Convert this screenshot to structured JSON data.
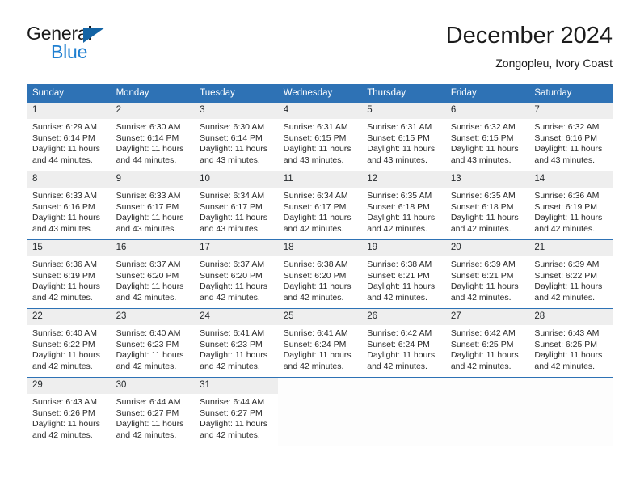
{
  "brand": {
    "word_one": "General",
    "word_two": "Blue",
    "logo_icon": "triangle-logo-icon",
    "color_blue": "#1f7fd0",
    "color_triangle": "#1464a5"
  },
  "header": {
    "title": "December 2024",
    "subtitle": "Zongopleu, Ivory Coast"
  },
  "calendar": {
    "header_color": "#2e72b5",
    "daynum_bg": "#eeeeee",
    "weekday_headers": [
      "Sunday",
      "Monday",
      "Tuesday",
      "Wednesday",
      "Thursday",
      "Friday",
      "Saturday"
    ],
    "weeks": [
      [
        {
          "day": "1",
          "sunrise": "Sunrise: 6:29 AM",
          "sunset": "Sunset: 6:14 PM",
          "daylight_line1": "Daylight: 11 hours",
          "daylight_line2": "and 44 minutes."
        },
        {
          "day": "2",
          "sunrise": "Sunrise: 6:30 AM",
          "sunset": "Sunset: 6:14 PM",
          "daylight_line1": "Daylight: 11 hours",
          "daylight_line2": "and 44 minutes."
        },
        {
          "day": "3",
          "sunrise": "Sunrise: 6:30 AM",
          "sunset": "Sunset: 6:14 PM",
          "daylight_line1": "Daylight: 11 hours",
          "daylight_line2": "and 43 minutes."
        },
        {
          "day": "4",
          "sunrise": "Sunrise: 6:31 AM",
          "sunset": "Sunset: 6:15 PM",
          "daylight_line1": "Daylight: 11 hours",
          "daylight_line2": "and 43 minutes."
        },
        {
          "day": "5",
          "sunrise": "Sunrise: 6:31 AM",
          "sunset": "Sunset: 6:15 PM",
          "daylight_line1": "Daylight: 11 hours",
          "daylight_line2": "and 43 minutes."
        },
        {
          "day": "6",
          "sunrise": "Sunrise: 6:32 AM",
          "sunset": "Sunset: 6:15 PM",
          "daylight_line1": "Daylight: 11 hours",
          "daylight_line2": "and 43 minutes."
        },
        {
          "day": "7",
          "sunrise": "Sunrise: 6:32 AM",
          "sunset": "Sunset: 6:16 PM",
          "daylight_line1": "Daylight: 11 hours",
          "daylight_line2": "and 43 minutes."
        }
      ],
      [
        {
          "day": "8",
          "sunrise": "Sunrise: 6:33 AM",
          "sunset": "Sunset: 6:16 PM",
          "daylight_line1": "Daylight: 11 hours",
          "daylight_line2": "and 43 minutes."
        },
        {
          "day": "9",
          "sunrise": "Sunrise: 6:33 AM",
          "sunset": "Sunset: 6:17 PM",
          "daylight_line1": "Daylight: 11 hours",
          "daylight_line2": "and 43 minutes."
        },
        {
          "day": "10",
          "sunrise": "Sunrise: 6:34 AM",
          "sunset": "Sunset: 6:17 PM",
          "daylight_line1": "Daylight: 11 hours",
          "daylight_line2": "and 43 minutes."
        },
        {
          "day": "11",
          "sunrise": "Sunrise: 6:34 AM",
          "sunset": "Sunset: 6:17 PM",
          "daylight_line1": "Daylight: 11 hours",
          "daylight_line2": "and 42 minutes."
        },
        {
          "day": "12",
          "sunrise": "Sunrise: 6:35 AM",
          "sunset": "Sunset: 6:18 PM",
          "daylight_line1": "Daylight: 11 hours",
          "daylight_line2": "and 42 minutes."
        },
        {
          "day": "13",
          "sunrise": "Sunrise: 6:35 AM",
          "sunset": "Sunset: 6:18 PM",
          "daylight_line1": "Daylight: 11 hours",
          "daylight_line2": "and 42 minutes."
        },
        {
          "day": "14",
          "sunrise": "Sunrise: 6:36 AM",
          "sunset": "Sunset: 6:19 PM",
          "daylight_line1": "Daylight: 11 hours",
          "daylight_line2": "and 42 minutes."
        }
      ],
      [
        {
          "day": "15",
          "sunrise": "Sunrise: 6:36 AM",
          "sunset": "Sunset: 6:19 PM",
          "daylight_line1": "Daylight: 11 hours",
          "daylight_line2": "and 42 minutes."
        },
        {
          "day": "16",
          "sunrise": "Sunrise: 6:37 AM",
          "sunset": "Sunset: 6:20 PM",
          "daylight_line1": "Daylight: 11 hours",
          "daylight_line2": "and 42 minutes."
        },
        {
          "day": "17",
          "sunrise": "Sunrise: 6:37 AM",
          "sunset": "Sunset: 6:20 PM",
          "daylight_line1": "Daylight: 11 hours",
          "daylight_line2": "and 42 minutes."
        },
        {
          "day": "18",
          "sunrise": "Sunrise: 6:38 AM",
          "sunset": "Sunset: 6:20 PM",
          "daylight_line1": "Daylight: 11 hours",
          "daylight_line2": "and 42 minutes."
        },
        {
          "day": "19",
          "sunrise": "Sunrise: 6:38 AM",
          "sunset": "Sunset: 6:21 PM",
          "daylight_line1": "Daylight: 11 hours",
          "daylight_line2": "and 42 minutes."
        },
        {
          "day": "20",
          "sunrise": "Sunrise: 6:39 AM",
          "sunset": "Sunset: 6:21 PM",
          "daylight_line1": "Daylight: 11 hours",
          "daylight_line2": "and 42 minutes."
        },
        {
          "day": "21",
          "sunrise": "Sunrise: 6:39 AM",
          "sunset": "Sunset: 6:22 PM",
          "daylight_line1": "Daylight: 11 hours",
          "daylight_line2": "and 42 minutes."
        }
      ],
      [
        {
          "day": "22",
          "sunrise": "Sunrise: 6:40 AM",
          "sunset": "Sunset: 6:22 PM",
          "daylight_line1": "Daylight: 11 hours",
          "daylight_line2": "and 42 minutes."
        },
        {
          "day": "23",
          "sunrise": "Sunrise: 6:40 AM",
          "sunset": "Sunset: 6:23 PM",
          "daylight_line1": "Daylight: 11 hours",
          "daylight_line2": "and 42 minutes."
        },
        {
          "day": "24",
          "sunrise": "Sunrise: 6:41 AM",
          "sunset": "Sunset: 6:23 PM",
          "daylight_line1": "Daylight: 11 hours",
          "daylight_line2": "and 42 minutes."
        },
        {
          "day": "25",
          "sunrise": "Sunrise: 6:41 AM",
          "sunset": "Sunset: 6:24 PM",
          "daylight_line1": "Daylight: 11 hours",
          "daylight_line2": "and 42 minutes."
        },
        {
          "day": "26",
          "sunrise": "Sunrise: 6:42 AM",
          "sunset": "Sunset: 6:24 PM",
          "daylight_line1": "Daylight: 11 hours",
          "daylight_line2": "and 42 minutes."
        },
        {
          "day": "27",
          "sunrise": "Sunrise: 6:42 AM",
          "sunset": "Sunset: 6:25 PM",
          "daylight_line1": "Daylight: 11 hours",
          "daylight_line2": "and 42 minutes."
        },
        {
          "day": "28",
          "sunrise": "Sunrise: 6:43 AM",
          "sunset": "Sunset: 6:25 PM",
          "daylight_line1": "Daylight: 11 hours",
          "daylight_line2": "and 42 minutes."
        }
      ],
      [
        {
          "day": "29",
          "sunrise": "Sunrise: 6:43 AM",
          "sunset": "Sunset: 6:26 PM",
          "daylight_line1": "Daylight: 11 hours",
          "daylight_line2": "and 42 minutes."
        },
        {
          "day": "30",
          "sunrise": "Sunrise: 6:44 AM",
          "sunset": "Sunset: 6:27 PM",
          "daylight_line1": "Daylight: 11 hours",
          "daylight_line2": "and 42 minutes."
        },
        {
          "day": "31",
          "sunrise": "Sunrise: 6:44 AM",
          "sunset": "Sunset: 6:27 PM",
          "daylight_line1": "Daylight: 11 hours",
          "daylight_line2": "and 42 minutes."
        },
        {
          "day": "",
          "sunrise": "",
          "sunset": "",
          "daylight_line1": "",
          "daylight_line2": ""
        },
        {
          "day": "",
          "sunrise": "",
          "sunset": "",
          "daylight_line1": "",
          "daylight_line2": ""
        },
        {
          "day": "",
          "sunrise": "",
          "sunset": "",
          "daylight_line1": "",
          "daylight_line2": ""
        },
        {
          "day": "",
          "sunrise": "",
          "sunset": "",
          "daylight_line1": "",
          "daylight_line2": ""
        }
      ]
    ]
  }
}
